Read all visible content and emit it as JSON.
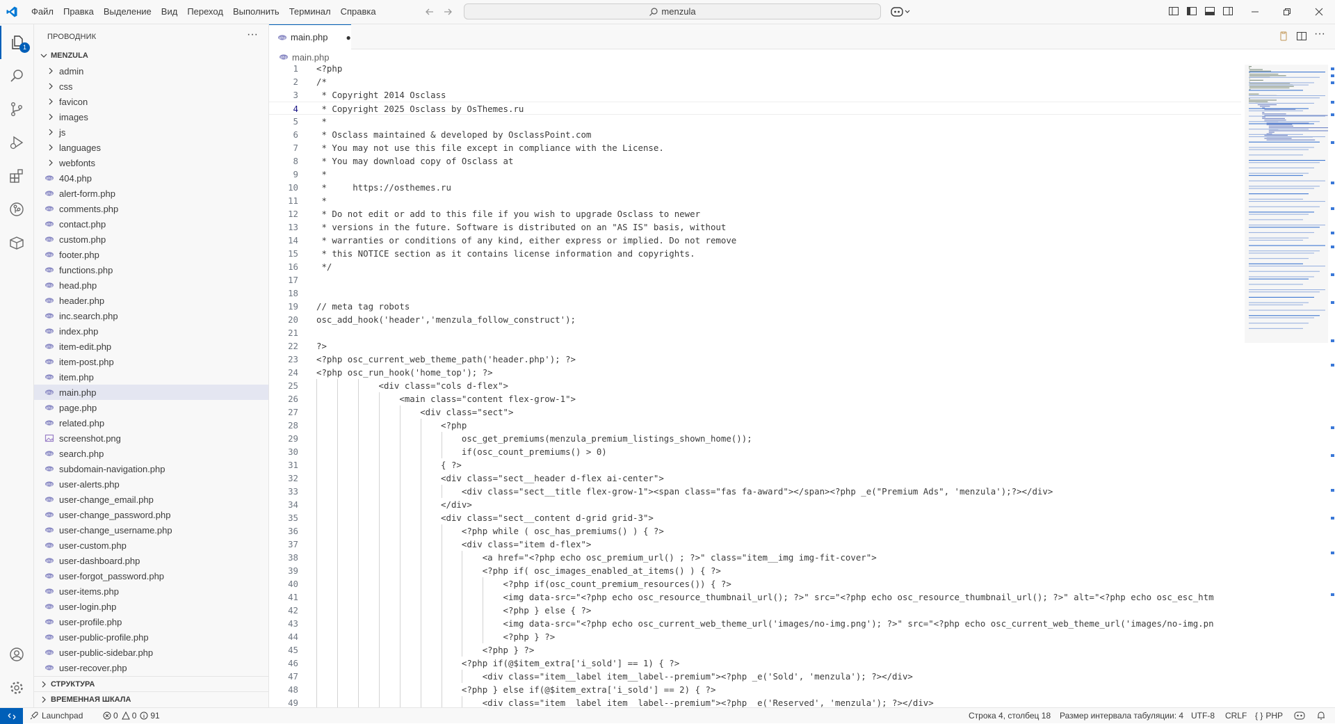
{
  "menu": [
    "Файл",
    "Правка",
    "Выделение",
    "Вид",
    "Переход",
    "Выполнить",
    "Терминал",
    "Справка"
  ],
  "command_center": {
    "text": "menzula"
  },
  "activity_badge": "1",
  "sidebar": {
    "title": "ПРОВОДНИК",
    "root": "MENZULA",
    "folders": [
      "admin",
      "css",
      "favicon",
      "images",
      "js",
      "languages",
      "webfonts"
    ],
    "files": [
      "404.php",
      "alert-form.php",
      "comments.php",
      "contact.php",
      "custom.php",
      "footer.php",
      "functions.php",
      "head.php",
      "header.php",
      "inc.search.php",
      "index.php",
      "item-edit.php",
      "item-post.php",
      "item.php",
      "main.php",
      "page.php",
      "related.php",
      "screenshot.png",
      "search.php",
      "subdomain-navigation.php",
      "user-alerts.php",
      "user-change_email.php",
      "user-change_password.php",
      "user-change_username.php",
      "user-custom.php",
      "user-dashboard.php",
      "user-forgot_password.php",
      "user-items.php",
      "user-login.php",
      "user-profile.php",
      "user-public-profile.php",
      "user-public-sidebar.php",
      "user-recover.php"
    ],
    "selected": "main.php",
    "outline": "СТРУКТУРА",
    "timeline": "ВРЕМЕННАЯ ШКАЛА"
  },
  "tab": {
    "name": "main.php",
    "dirty": "●"
  },
  "breadcrumb": "main.php",
  "editor": {
    "current_line": 4,
    "lines": [
      "<?php",
      "/*",
      " * Copyright 2014 Osclass",
      " * Copyright 2025 Osclass by OsThemes.ru",
      " *",
      " * Osclass maintained & developed by OsclassPoint.com",
      " * You may not use this file except in compliance with the License.",
      " * You may download copy of Osclass at",
      " *",
      " *     https://osthemes.ru",
      " *",
      " * Do not edit or add to this file if you wish to upgrade Osclass to newer",
      " * versions in the future. Software is distributed on an \"AS IS\" basis, without",
      " * warranties or conditions of any kind, either express or implied. Do not remove",
      " * this NOTICE section as it contains license information and copyrights.",
      " */",
      "",
      "",
      "// meta tag robots",
      "osc_add_hook('header','menzula_follow_construct');",
      "",
      "?>",
      "<?php osc_current_web_theme_path('header.php'); ?>",
      "<?php osc_run_hook('home_top'); ?>",
      "            <div class=\"cols d-flex\">",
      "                <main class=\"content flex-grow-1\">",
      "                    <div class=\"sect\">",
      "                        <?php",
      "                            osc_get_premiums(menzula_premium_listings_shown_home());",
      "                            if(osc_count_premiums() > 0)",
      "                        { ?>",
      "                        <div class=\"sect__header d-flex ai-center\">",
      "                            <div class=\"sect__title flex-grow-1\"><span class=\"fas fa-award\"></span><?php _e(\"Premium Ads\", 'menzula');?></div>",
      "                        </div>",
      "                        <div class=\"sect__content d-grid grid-3\">",
      "                            <?php while ( osc_has_premiums() ) { ?>",
      "                            <div class=\"item d-flex\">",
      "                                <a href=\"<?php echo osc_premium_url() ; ?>\" class=\"item__img img-fit-cover\">",
      "                                <?php if( osc_images_enabled_at_items() ) { ?>",
      "                                    <?php if(osc_count_premium_resources()) { ?>",
      "                                    <img data-src=\"<?php echo osc_resource_thumbnail_url(); ?>\" src=\"<?php echo osc_resource_thumbnail_url(); ?>\" alt=\"<?php echo osc_esc_htm",
      "                                    <?php } else { ?>",
      "                                    <img data-src=\"<?php echo osc_current_web_theme_url('images/no-img.png'); ?>\" src=\"<?php echo osc_current_web_theme_url('images/no-img.pn",
      "                                    <?php } ?>",
      "                                <?php } ?>",
      "                            <?php if(@$item_extra['i_sold'] == 1) { ?>",
      "                                <div class=\"item__label item__label--premium\"><?php _e('Sold', 'menzula'); ?></div>",
      "                            <?php } else if(@$item_extra['i_sold'] == 2) { ?>",
      "                                <div class=\"item__label item__label--premium\"><?php _e('Reserved', 'menzula'); ?></div>"
    ]
  },
  "status": {
    "launchpad": "Launchpad",
    "errors": "0",
    "warnings": "0",
    "info": "91",
    "position": "Строка 4, столбец 18",
    "indent": "Размер интервала табуляции: 4",
    "encoding": "UTF-8",
    "eol": "CRLF",
    "language": "PHP"
  },
  "colors": {
    "accent": "#005fb8",
    "php_icon": "#8a8ac4",
    "img_icon": "#9a7fc7"
  }
}
